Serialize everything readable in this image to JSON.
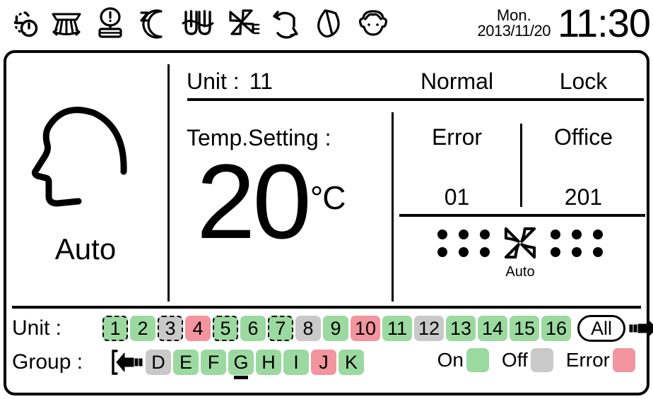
{
  "colors": {
    "on_green": "#9BD9A0",
    "off_gray": "#C9C9C9",
    "error_red": "#F2959E",
    "foreground": "#000000",
    "background": "#FFFFFF"
  },
  "status_bar": {
    "icons": [
      {
        "name": "timer-power-icon",
        "label": "Timer"
      },
      {
        "name": "air-swing-louver-icon",
        "label": "Air Swing"
      },
      {
        "name": "filter-alert-icon",
        "label": "Filter Sign"
      },
      {
        "name": "sleep-moon-icon",
        "label": "Sleep"
      },
      {
        "name": "ventilation-icon",
        "label": "Ventilation"
      },
      {
        "name": "fan-icon",
        "label": "Fan Speed"
      },
      {
        "name": "rotation-cycle-icon",
        "label": "Rotation"
      },
      {
        "name": "eco-leaf-icon",
        "label": "Energy Save"
      },
      {
        "name": "child-face-icon",
        "label": "Human Sensor"
      }
    ],
    "weekday": "Mon.",
    "date": "2013/11/20",
    "time": "11:30"
  },
  "mode": {
    "icon": "head-profile-icon",
    "label": "Auto"
  },
  "unit_info": {
    "unit_label": "Unit :",
    "unit_value": "11"
  },
  "temperature": {
    "label": "Temp.Setting :",
    "value": "20",
    "unit": "°C"
  },
  "status": {
    "operation": "Normal",
    "lock": "Lock"
  },
  "detail": {
    "error_label": "Error",
    "error_value": "01",
    "zone_label": "Office",
    "zone_value": "201"
  },
  "fan": {
    "icon": "fan-icon",
    "label": "Auto",
    "left_dots": 6,
    "right_dots": 6
  },
  "unit_row": {
    "label": "Unit :",
    "cells": [
      {
        "text": "1",
        "state": "on",
        "selected": true
      },
      {
        "text": "2",
        "state": "on",
        "selected": false
      },
      {
        "text": "3",
        "state": "off",
        "selected": true
      },
      {
        "text": "4",
        "state": "error",
        "selected": false
      },
      {
        "text": "5",
        "state": "on",
        "selected": true
      },
      {
        "text": "6",
        "state": "on",
        "selected": false
      },
      {
        "text": "7",
        "state": "on",
        "selected": true
      },
      {
        "text": "8",
        "state": "off",
        "selected": false
      },
      {
        "text": "9",
        "state": "on",
        "selected": false
      },
      {
        "text": "10",
        "state": "error",
        "selected": false
      },
      {
        "text": "11",
        "state": "on",
        "selected": false
      },
      {
        "text": "12",
        "state": "off",
        "selected": false
      },
      {
        "text": "13",
        "state": "on",
        "selected": false
      },
      {
        "text": "14",
        "state": "on",
        "selected": false
      },
      {
        "text": "15",
        "state": "on",
        "selected": false
      },
      {
        "text": "16",
        "state": "on",
        "selected": false
      }
    ],
    "all_button": "All",
    "next_icon": "arrow-right-icon"
  },
  "group_row": {
    "label": "Group :",
    "prev_icon": "arrow-left-icon",
    "cells": [
      {
        "text": "D",
        "state": "off",
        "underline": false
      },
      {
        "text": "E",
        "state": "on",
        "underline": false
      },
      {
        "text": "F",
        "state": "on",
        "underline": false
      },
      {
        "text": "G",
        "state": "on",
        "underline": true
      },
      {
        "text": "H",
        "state": "on",
        "underline": false
      },
      {
        "text": "I",
        "state": "on",
        "underline": false
      },
      {
        "text": "J",
        "state": "error",
        "underline": false
      },
      {
        "text": "K",
        "state": "on",
        "underline": false
      }
    ]
  },
  "legend": {
    "items": [
      {
        "label": "On",
        "state": "on"
      },
      {
        "label": "Off",
        "state": "off"
      },
      {
        "label": "Error",
        "state": "error"
      }
    ]
  }
}
